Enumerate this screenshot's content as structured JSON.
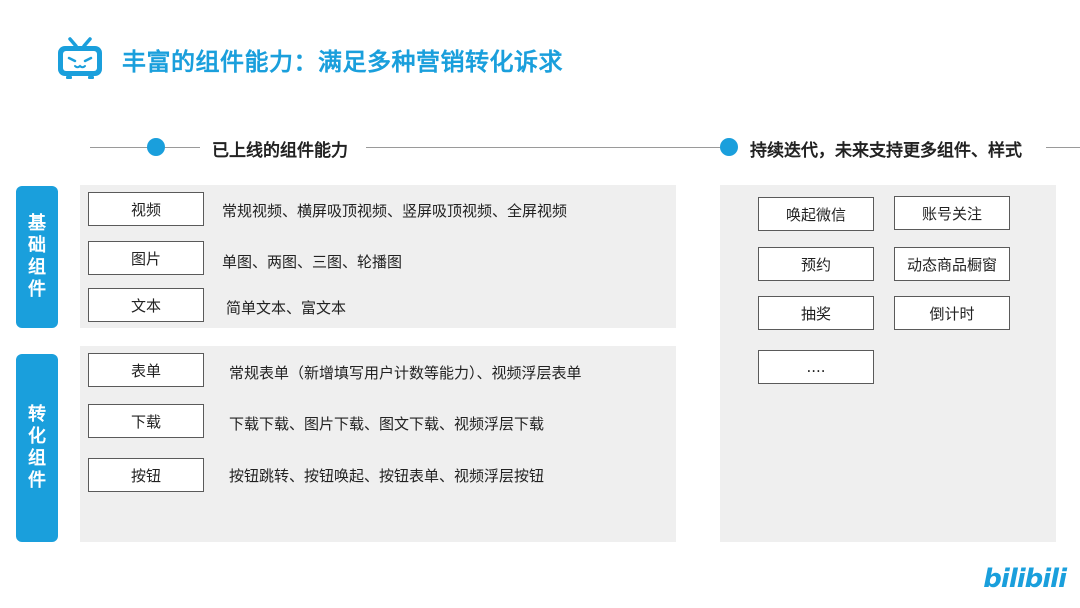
{
  "title": "丰富的组件能力：满足多种营销转化诉求",
  "timeline": {
    "left_label": "已上线的组件能力",
    "right_label": "持续迭代，未来支持更多组件、样式"
  },
  "basic": {
    "tab": [
      "基",
      "础",
      "组",
      "件"
    ],
    "rows": [
      {
        "name": "视频",
        "desc": "常规视频、横屏吸顶视频、竖屏吸顶视频、全屏视频"
      },
      {
        "name": "图片",
        "desc": "单图、两图、三图、轮播图"
      },
      {
        "name": "文本",
        "desc": "简单文本、富文本"
      }
    ]
  },
  "conversion": {
    "tab": [
      "转",
      "化",
      "组",
      "件"
    ],
    "rows": [
      {
        "name": "表单",
        "desc": "常规表单（新增填写用户计数等能力）、视频浮层表单"
      },
      {
        "name": "下载",
        "desc": "下载下载、图片下载、图文下载、视频浮层下载"
      },
      {
        "name": "按钮",
        "desc": "按钮跳转、按钮唤起、按钮表单、视频浮层按钮"
      }
    ]
  },
  "future": {
    "items": [
      "唤起微信",
      "账号关注",
      "预约",
      "动态商品橱窗",
      "抽奖",
      "倒计时",
      "...."
    ]
  },
  "brand": "bilibili",
  "colors": {
    "accent": "#1a9fdc",
    "panel": "#efefef"
  }
}
